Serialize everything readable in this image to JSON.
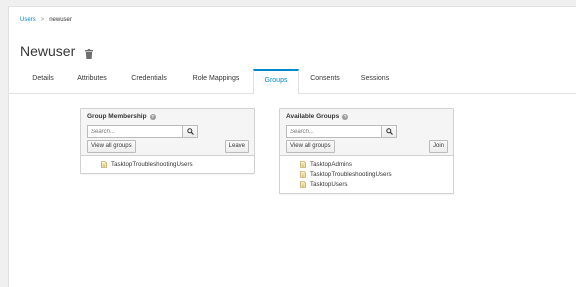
{
  "breadcrumb": {
    "parent": "Users",
    "separator": ">",
    "current": "newuser"
  },
  "page": {
    "title": "Newuser",
    "delete_icon": "trash-icon"
  },
  "tabs": [
    {
      "label": "Details"
    },
    {
      "label": "Attributes"
    },
    {
      "label": "Credentials"
    },
    {
      "label": "Role Mappings"
    },
    {
      "label": "Groups",
      "active": true
    },
    {
      "label": "Consents"
    },
    {
      "label": "Sessions"
    }
  ],
  "membership": {
    "title": "Group Membership",
    "search_placeholder": "Search...",
    "view_all_label": "View all groups",
    "action_label": "Leave",
    "groups": [
      "TasktopTroubleshootingUsers"
    ]
  },
  "available": {
    "title": "Available Groups",
    "search_placeholder": "Search...",
    "view_all_label": "View all groups",
    "action_label": "Join",
    "groups": [
      "TasktopAdmins",
      "TasktopTroubleshootingUsers",
      "TasktopUsers"
    ]
  },
  "colors": {
    "accent": "#0088ce",
    "panel_header": "#f5f5f5",
    "border": "#d1d1d1"
  }
}
